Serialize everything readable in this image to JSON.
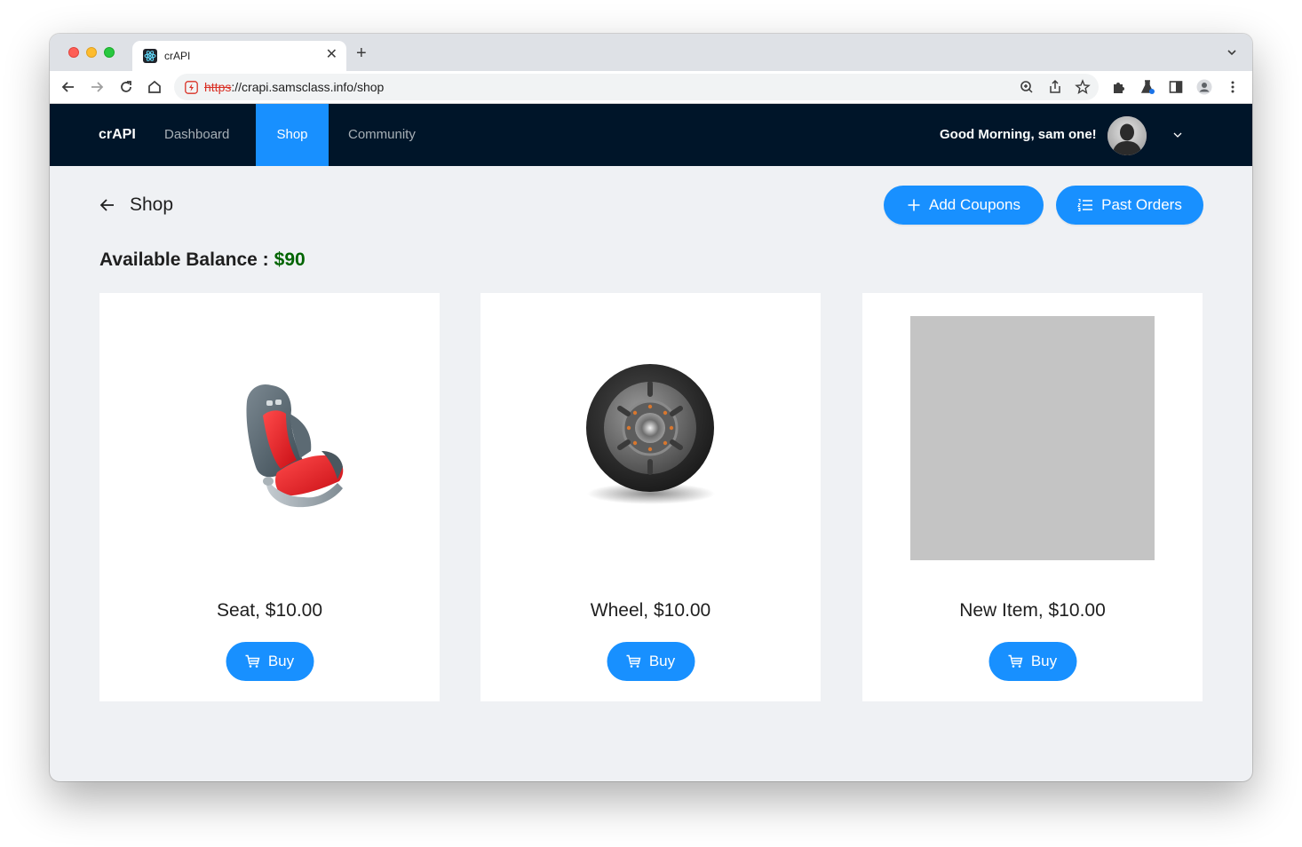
{
  "browser": {
    "tab_title": "crAPI",
    "url_scheme": "https",
    "url_rest": "://crapi.samsclass.info/shop",
    "icons": [
      "react-icon",
      "close-icon",
      "plus-icon",
      "chevron-down-icon",
      "back-icon",
      "forward-icon",
      "reload-icon",
      "home-icon",
      "not-secure-icon",
      "zoom-icon",
      "share-icon",
      "star-icon",
      "extensions-icon",
      "labs-icon",
      "side-panel-icon",
      "profile-icon",
      "menu-icon"
    ]
  },
  "navbar": {
    "brand": "crAPI",
    "items": [
      {
        "label": "Dashboard",
        "active": false
      },
      {
        "label": "Shop",
        "active": true
      },
      {
        "label": "Community",
        "active": false
      }
    ],
    "greeting": "Good Morning, sam one!",
    "colors": {
      "background": "#001529",
      "active": "#1890ff"
    }
  },
  "page": {
    "title": "Shop",
    "add_coupons_label": "Add Coupons",
    "past_orders_label": "Past Orders",
    "balance_label": "Available Balance :",
    "balance_value": "$90",
    "balance_color": "#006400"
  },
  "products": [
    {
      "title": "Seat, $10.00",
      "buy_label": "Buy",
      "image": "car-seat"
    },
    {
      "title": "Wheel, $10.00",
      "buy_label": "Buy",
      "image": "wheel"
    },
    {
      "title": "New Item, $10.00",
      "buy_label": "Buy",
      "image": "gray-placeholder"
    }
  ]
}
